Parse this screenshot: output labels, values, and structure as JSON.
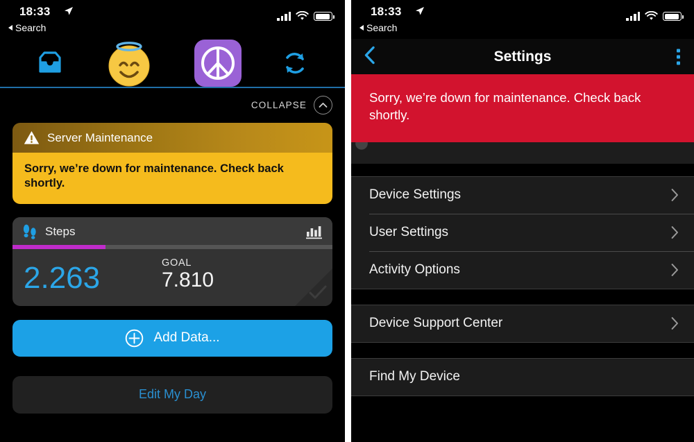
{
  "status_bar": {
    "time": "18:33",
    "back_label": "Search",
    "location_icon": "location-arrow-icon",
    "signal_icon": "cellular-signal-icon",
    "wifi_icon": "wifi-icon",
    "battery_icon": "battery-icon"
  },
  "colors": {
    "accent_blue": "#1ca1e6",
    "steps_value_blue": "#2ba6e8",
    "progress_magenta": "#c02ccb",
    "alert_amber": "#f5bb1d",
    "alert_amber_header": "#b8891a",
    "alert_red": "#d2132e",
    "app_tile_purple": "#9a62d6",
    "panel_dark": "#1c1c1c"
  },
  "left_panel": {
    "tabs": [
      {
        "name": "inbox-tab",
        "icon": "inbox-tray-icon"
      },
      {
        "name": "profile-tab",
        "icon": "smiling-face-with-halo-emoji"
      },
      {
        "name": "peace-app-tab",
        "icon": "peace-symbol-icon"
      },
      {
        "name": "sync-tab",
        "icon": "sync-refresh-icon"
      }
    ],
    "collapse": {
      "label": "COLLAPSE",
      "icon": "chevron-up-icon"
    },
    "maintenance_card": {
      "icon": "warning-triangle-icon",
      "title": "Server Maintenance",
      "message": "Sorry, we’re down for maintenance. Check back shortly."
    },
    "steps_card": {
      "icon": "footprints-icon",
      "label": "Steps",
      "chart_icon": "bar-chart-icon",
      "value": "2.263",
      "goal_label": "GOAL",
      "goal_value": "7.810",
      "progress_percent": 29,
      "completed_icon": "checkmark-icon"
    },
    "add_data_button": {
      "label": "Add Data...",
      "icon": "plus-circle-icon"
    },
    "edit_day_button": {
      "label": "Edit My Day"
    }
  },
  "right_panel": {
    "nav": {
      "back_icon": "chevron-left-icon",
      "title": "Settings",
      "menu_icon": "overflow-menu-icon"
    },
    "alert": {
      "message": "Sorry, we’re down for maintenance. Check back shortly."
    },
    "groups": [
      {
        "items": [
          {
            "label": "Device Settings",
            "chevron": true
          },
          {
            "label": "User Settings",
            "chevron": true
          },
          {
            "label": "Activity Options",
            "chevron": true
          }
        ]
      },
      {
        "items": [
          {
            "label": "Device Support Center",
            "chevron": true
          }
        ]
      },
      {
        "items": [
          {
            "label": "Find My Device",
            "chevron": false
          }
        ]
      }
    ]
  },
  "chart_data": {
    "type": "bar",
    "title": "Steps progress toward daily goal",
    "categories": [
      "Steps"
    ],
    "values": [
      2263
    ],
    "goal": 7810,
    "percent_of_goal": 29,
    "ylabel": "Steps",
    "xlabel": ""
  }
}
